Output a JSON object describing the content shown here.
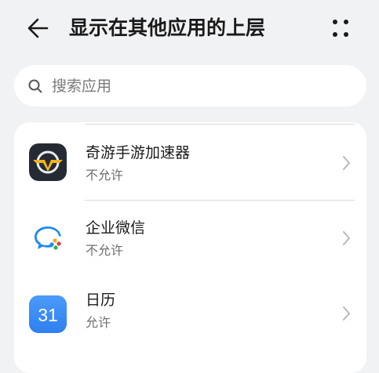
{
  "header": {
    "title": "显示在其他应用的上层",
    "back_icon": "arrow-left-icon",
    "more_icon": "more-dots-icon"
  },
  "search": {
    "placeholder": "搜索应用",
    "value": ""
  },
  "apps": [
    {
      "name": "奇游手游加速器",
      "status": "不允许",
      "icon": "qiyou-accelerator-icon"
    },
    {
      "name": "企业微信",
      "status": "不允许",
      "icon": "wecom-icon"
    },
    {
      "name": "日历",
      "status": "允许",
      "icon": "calendar-icon",
      "icon_text": "31"
    }
  ],
  "colors": {
    "background": "#f1f2f4",
    "card": "#ffffff",
    "primary_text": "#1a1a1a",
    "secondary_text": "#6f6f6f",
    "calendar_blue": "#3d8cf5",
    "qiyou_dark": "#262b33",
    "qiyou_gold": "#f2b41e"
  }
}
